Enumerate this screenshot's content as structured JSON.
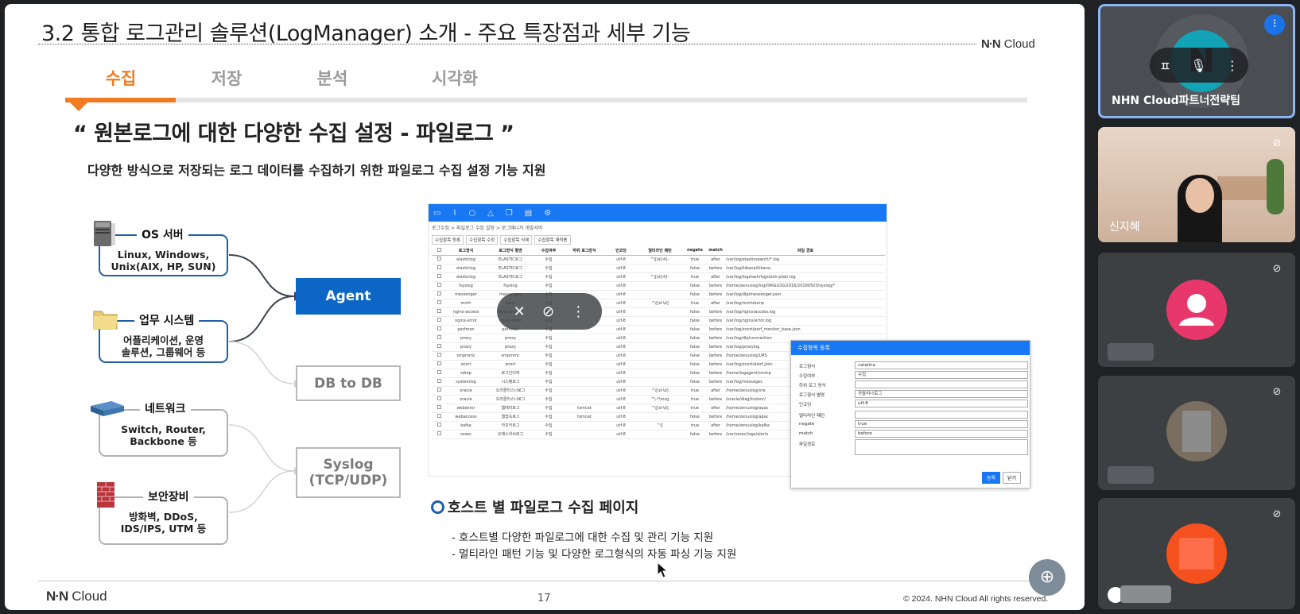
{
  "slide": {
    "title": "3.2 통합 로그관리 솔루션(LogManager) 소개 - 주요 특장점과 세부 기능",
    "brand": "Cloud",
    "brand_mark": "N·N",
    "tabs": [
      "수집",
      "저장",
      "분석",
      "시각화"
    ],
    "active_tab": "수집",
    "headline": "“ 원본로그에 대한 다양한 수집 설정 - 파일로그 ”",
    "subline": "다양한 방식으로 저장되는 로그 데이터를 수집하기 위한 파일로그 수집 설정 기능 지원",
    "sources": [
      {
        "label": "OS 서버",
        "line1": "Linux, Windows,",
        "line2": "Unix(AIX, HP, SUN)",
        "icon": "server-icon"
      },
      {
        "label": "업무 시스템",
        "line1": "어플리케이션, 운영",
        "line2": "솔루션, 그룹웨어 등",
        "icon": "folder-icon"
      },
      {
        "label": "네트워크",
        "line1": "Switch, Router,",
        "line2": "Backbone 등",
        "icon": "switch-icon"
      },
      {
        "label": "보안장비",
        "line1": "방화벽, DDoS,",
        "line2": "IDS/IPS, UTM 등",
        "icon": "firewall-icon"
      }
    ],
    "targets": {
      "agent": "Agent",
      "db": "DB to DB",
      "syslog_1": "Syslog",
      "syslog_2": "(TCP/UDP)"
    },
    "screenshot": {
      "crumb": "로그수집 > 파일로그 수집 설정 > 로그매니저 개발서버",
      "buttons": [
        "수집항목 등록",
        "수집항목 수정",
        "수집항목 삭제",
        "수집항목 재적용"
      ],
      "columns": [
        "로그형식",
        "로그형식 별명",
        "수집여부",
        "하위 로그방식",
        "인코딩",
        "멀티라인 패턴",
        "negate",
        "match",
        "파일 경로"
      ],
      "rows": [
        [
          "elasticlog",
          "ELASTIC로그",
          "수집",
          "",
          "utf-8",
          "^\\[\\d{4}-",
          "true",
          "after",
          "/var/log/elasticsearch/*.log"
        ],
        [
          "elasticlog",
          "ELASTIC로그",
          "수집",
          "",
          "utf-8",
          "",
          "false",
          "before",
          "/var/log/kibana/kibana"
        ],
        [
          "elasticlog",
          "ELASTIC로그",
          "수집",
          "",
          "utf-8",
          "^\\[\\d{4}-",
          "true",
          "after",
          "/var/log/logstash/logstash-plain.log"
        ],
        [
          "fsyslog",
          "fsyslog",
          "수집",
          "",
          "utf-8",
          "",
          "false",
          "before",
          "/home/zenuslog/log/ORIGLOG/2016/20180503/syslog/*"
        ],
        [
          "messenger",
          "messenger",
          "수집",
          "",
          "utf-8",
          "",
          "false",
          "before",
          "/var/log/dlp/messenger.json"
        ],
        [
          "mmh",
          "mmh",
          "수집",
          "",
          "utf-8",
          "^\\[\\d-\\d]",
          "true",
          "after",
          "/var/log/mmhdump"
        ],
        [
          "nginx-access",
          "nginx-access",
          "수집",
          "",
          "utf-8",
          "",
          "false",
          "before",
          "/var/log/nginx/access.log"
        ],
        [
          "nginx-error",
          "nginx-error",
          "수집",
          "",
          "utf-8",
          "",
          "false",
          "before",
          "/var/log/nginx/error.log"
        ],
        [
          "perfmon",
          "perfmon",
          "수집",
          "",
          "utf-8",
          "",
          "false",
          "before",
          "/var/log/snort/perf_monitor_base.json"
        ],
        [
          "proxy",
          "proxy",
          "수집",
          "",
          "utf-8",
          "",
          "false",
          "before",
          "/var/log/dlp/connection"
        ],
        [
          "proxy",
          "proxy",
          "수집",
          "",
          "utf-8",
          "",
          "false",
          "before",
          "/var/log/proxylog"
        ],
        [
          "smpmmc",
          "smpmmc",
          "수집",
          "",
          "utf-8",
          "",
          "false",
          "before",
          "/home/zenuslog/LMS"
        ],
        [
          "snort",
          "snort",
          "수집",
          "",
          "utf-8",
          "",
          "false",
          "before",
          "/var/log/snort/alert.json"
        ],
        [
          "sdmp",
          "로그인이력",
          "수집",
          "",
          "utf-8",
          "",
          "false",
          "before",
          "/home/logagent/smmp"
        ],
        [
          "systemlog",
          "시스템로그",
          "수집",
          "",
          "utf-8",
          "",
          "false",
          "before",
          "/var/log/messages"
        ],
        [
          "oracle",
          "오라클리스너로그",
          "수집",
          "",
          "utf-8",
          "^\\[\\d-\\d]",
          "true",
          "after",
          "/home/zenuslog/ora"
        ],
        [
          "oracle",
          "오라클리스너로그",
          "수집",
          "",
          "utf-8",
          "^\\-*\\msg",
          "true",
          "before",
          "/oracle/diag/tnslsnr/"
        ],
        [
          "webseror",
          "웹에러로그",
          "수집",
          "tomcat",
          "utf-8",
          "^\\[\\d-\\d]",
          "true",
          "after",
          "/home/zenuslog/apac"
        ],
        [
          "webaccess",
          "웹접속로그",
          "수집",
          "tomcat",
          "utf-8",
          "",
          "false",
          "before",
          "/home/zenuslog/apac"
        ],
        [
          "kafka",
          "카프카로그",
          "수집",
          "",
          "utf-8",
          "^\\[",
          "true",
          "after",
          "/home/zenuslog/kafka"
        ],
        [
          "ossec",
          "오에스이씨로그",
          "수집",
          "",
          "utf-8",
          "",
          "false",
          "before",
          "/var/ossec/logs/alerts"
        ]
      ]
    },
    "dialog": {
      "title": "수집항목 등록",
      "fields": [
        {
          "key": "로그형식",
          "value": "catalina"
        },
        {
          "key": "수집여부",
          "value": "수집"
        },
        {
          "key": "하위 로그 방식",
          "value": ""
        },
        {
          "key": "로그형식 별명",
          "value": "카탈리나로그"
        },
        {
          "key": "인코딩",
          "value": "utf-8"
        },
        {
          "key": "멀티라인 패턴",
          "value": ""
        },
        {
          "key": "negate",
          "value": "true"
        },
        {
          "key": "match",
          "value": "before"
        },
        {
          "key": "파일경로",
          "value": ""
        }
      ],
      "ok": "등록",
      "close": "닫기"
    },
    "host_title": "호스트 별 파일로그 수집 페이지",
    "bullets": [
      "- 호스트별 다양한 파일로그에 대한 수집 및 관리 기능 지원",
      "- 멀티라인 패턴 기능 및 다양한 로그형식의 자동 파싱 기능 지원"
    ],
    "page_number": "17",
    "copyright": "© 2024. NHN Cloud All rights reserved."
  },
  "participants": [
    {
      "name": "NHN Cloud파트너전략팀",
      "state": "presenting",
      "initial": "N",
      "pin_label": "ㅍ"
    },
    {
      "name": "신지혜",
      "state": "camera"
    },
    {
      "name": "",
      "state": "avatar",
      "avatar_color": "#e8386b"
    },
    {
      "name": "",
      "state": "photo"
    },
    {
      "name": "",
      "state": "avatar",
      "avatar_color": "#f4511e"
    }
  ],
  "colors": {
    "accent": "#f07b22",
    "brand_blue": "#1f5fa9",
    "meet_bg": "#202124",
    "tile_bg": "#3c4043"
  }
}
